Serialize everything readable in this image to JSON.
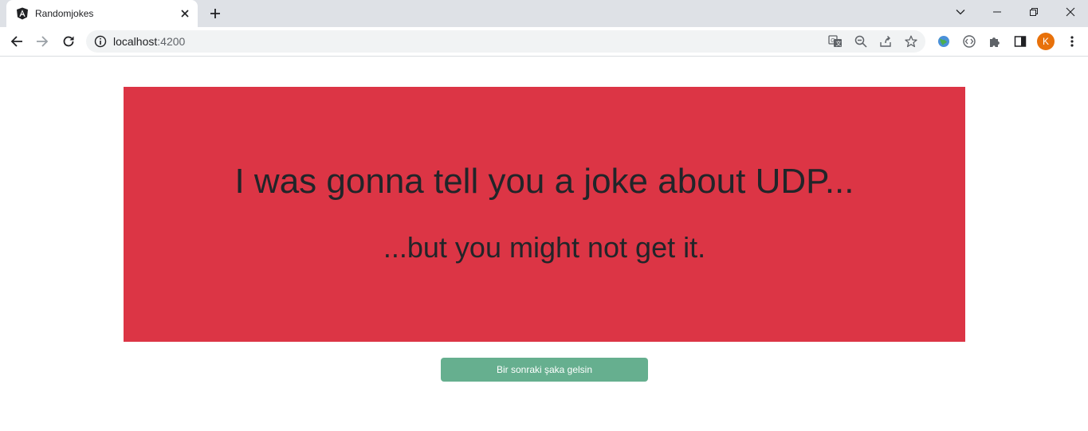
{
  "browser": {
    "tab_title": "Randomjokes",
    "url_host": "localhost",
    "url_port": ":4200",
    "profile_initial": "K"
  },
  "joke": {
    "setup": "I was gonna tell you a joke about UDP...",
    "punchline": "...but you might not get it.",
    "card_color": "#dc3545"
  },
  "next_button": {
    "label": "Bir sonraki şaka gelsin",
    "color": "#66af8f"
  }
}
